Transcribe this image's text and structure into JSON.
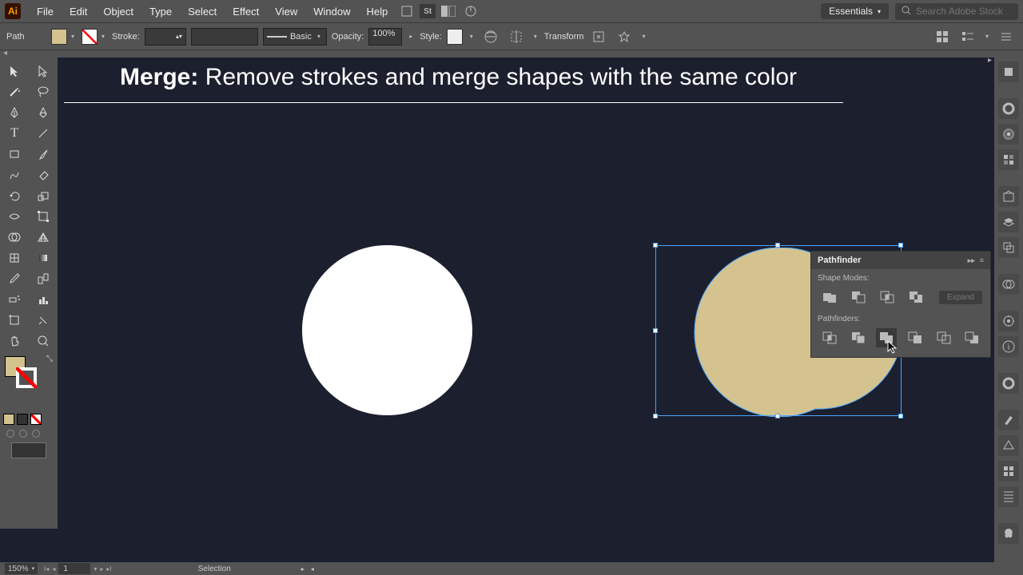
{
  "menu": {
    "logo": "Ai",
    "items": [
      "File",
      "Edit",
      "Object",
      "Type",
      "Select",
      "Effect",
      "View",
      "Window",
      "Help"
    ],
    "workspace": "Essentials",
    "search_placeholder": "Search Adobe Stock"
  },
  "control": {
    "path_label": "Path",
    "stroke_label": "Stroke:",
    "basic_label": "Basic",
    "opacity_label": "Opacity:",
    "opacity_val": "100%",
    "style_label": "Style:",
    "transform_label": "Transform"
  },
  "heading": {
    "bold": "Merge:",
    "rest": " Remove strokes and merge shapes with the same color"
  },
  "colors": {
    "tan": "#d4c28f",
    "canvas": "#1c1f2e",
    "sel": "#4aa7ff"
  },
  "pathfinder": {
    "title": "Pathfinder",
    "modes_label": "Shape Modes:",
    "finders_label": "Pathfinders:",
    "expand": "Expand"
  },
  "status": {
    "zoom": "150%",
    "artboard": "1",
    "tool": "Selection"
  }
}
